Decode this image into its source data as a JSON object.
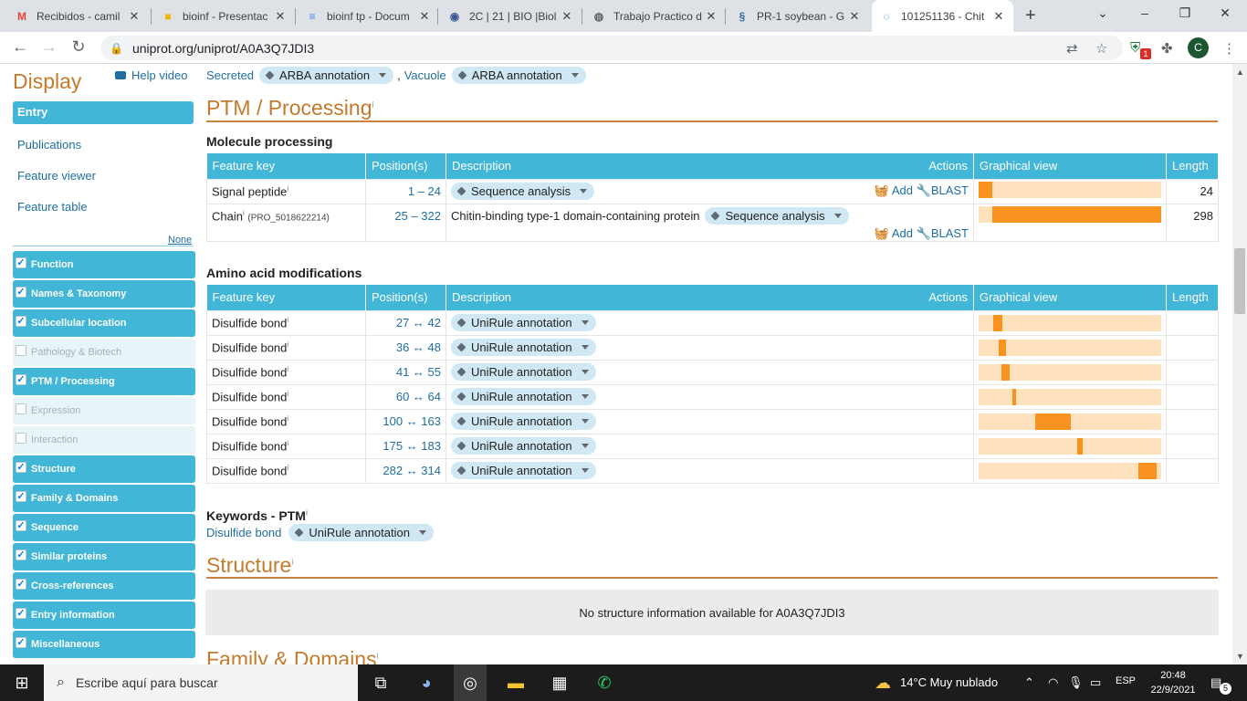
{
  "browser": {
    "tabs": [
      {
        "title": "Recibidos - camil",
        "icon": "gmail-icon",
        "icon_char": "M",
        "color": "#ea4335"
      },
      {
        "title": "bioinf - Presentac",
        "icon": "slides-icon",
        "icon_char": "■",
        "color": "#f4b400"
      },
      {
        "title": "bioinf tp - Docum",
        "icon": "docs-icon",
        "icon_char": "≡",
        "color": "#4285f4"
      },
      {
        "title": "2C | 21 | BIO |Biol",
        "icon": "moodle-icon",
        "icon_char": "◉",
        "color": "#3b5998"
      },
      {
        "title": "Trabajo Practico d",
        "icon": "globe-icon",
        "icon_char": "◍",
        "color": "#5f6368"
      },
      {
        "title": "PR-1 soybean - G",
        "icon": "ncbi-icon",
        "icon_char": "§",
        "color": "#3a6ea5"
      },
      {
        "title": "101251136 - Chit",
        "icon": "loading-icon",
        "icon_char": "◌",
        "color": "#1a73e8"
      }
    ],
    "url": "uniprot.org/uniprot/A0A3Q7JDI3",
    "profile_initial": "C",
    "extension_badge": "1"
  },
  "sidebar": {
    "title": "Display",
    "help_video": "Help video",
    "entry": "Entry",
    "links": [
      "Publications",
      "Feature viewer",
      "Feature table"
    ],
    "none_label": "None",
    "sections": [
      {
        "label": "Function",
        "checked": true
      },
      {
        "label": "Names & Taxonomy",
        "checked": true
      },
      {
        "label": "Subcellular location",
        "checked": true
      },
      {
        "label": "Pathology & Biotech",
        "checked": false
      },
      {
        "label": "PTM / Processing",
        "checked": true
      },
      {
        "label": "Expression",
        "checked": false
      },
      {
        "label": "Interaction",
        "checked": false
      },
      {
        "label": "Structure",
        "checked": true
      },
      {
        "label": "Family & Domains",
        "checked": true
      },
      {
        "label": "Sequence",
        "checked": true
      },
      {
        "label": "Similar proteins",
        "checked": true
      },
      {
        "label": "Cross-references",
        "checked": true
      },
      {
        "label": "Entry information",
        "checked": true
      },
      {
        "label": "Miscellaneous",
        "checked": true
      }
    ]
  },
  "location_line": {
    "items": [
      {
        "label": "Secreted",
        "evidence": "ARBA annotation"
      },
      {
        "label": "Vacuole",
        "evidence": "ARBA annotation"
      }
    ],
    "separator": ","
  },
  "ptm": {
    "title": "PTM / Processing",
    "info_mark": "i",
    "molecule_processing": {
      "title": "Molecule processing",
      "headers": [
        "Feature key",
        "Position(s)",
        "Description",
        "Actions",
        "Graphical view",
        "Length"
      ],
      "rows": [
        {
          "key": "Signal peptide",
          "extra": "",
          "positions": "1 – 24",
          "description": "",
          "evidence": "Sequence analysis",
          "add": "Add",
          "blast": "BLAST",
          "start": 1,
          "end": 24,
          "length": "24"
        },
        {
          "key": "Chain",
          "extra": "(PRO_5018622214)",
          "positions": "25 – 322",
          "description": "Chitin-binding type-1 domain-containing protein",
          "evidence": "Sequence analysis",
          "add": "Add",
          "blast": "BLAST",
          "start": 25,
          "end": 322,
          "length": "298"
        }
      ]
    },
    "amino_acid_modifications": {
      "title": "Amino acid modifications",
      "headers": [
        "Feature key",
        "Position(s)",
        "Description",
        "Actions",
        "Graphical view",
        "Length"
      ],
      "rows": [
        {
          "key": "Disulfide bond",
          "positions": "27 ↔ 42",
          "evidence": "UniRule annotation",
          "start": 27,
          "end": 42
        },
        {
          "key": "Disulfide bond",
          "positions": "36 ↔ 48",
          "evidence": "UniRule annotation",
          "start": 36,
          "end": 48
        },
        {
          "key": "Disulfide bond",
          "positions": "41 ↔ 55",
          "evidence": "UniRule annotation",
          "start": 41,
          "end": 55
        },
        {
          "key": "Disulfide bond",
          "positions": "60 ↔ 64",
          "evidence": "UniRule annotation",
          "start": 60,
          "end": 64
        },
        {
          "key": "Disulfide bond",
          "positions": "100 ↔ 163",
          "evidence": "UniRule annotation",
          "start": 100,
          "end": 163
        },
        {
          "key": "Disulfide bond",
          "positions": "175 ↔ 183",
          "evidence": "UniRule annotation",
          "start": 175,
          "end": 183
        },
        {
          "key": "Disulfide bond",
          "positions": "282 ↔ 314",
          "evidence": "UniRule annotation",
          "start": 282,
          "end": 314
        }
      ]
    },
    "keywords": {
      "title": "Keywords - PTM",
      "keyword": "Disulfide bond",
      "evidence": "UniRule annotation"
    }
  },
  "structure": {
    "title": "Structure",
    "message": "No structure information available for A0A3Q7JDI3"
  },
  "next_section": {
    "title": "Family & Domains"
  },
  "taskbar": {
    "search_placeholder": "Escribe aquí para buscar",
    "weather": "14°C  Muy nublado",
    "language": "ESP",
    "time": "20:48",
    "date": "22/9/2021",
    "notifications": "5"
  }
}
